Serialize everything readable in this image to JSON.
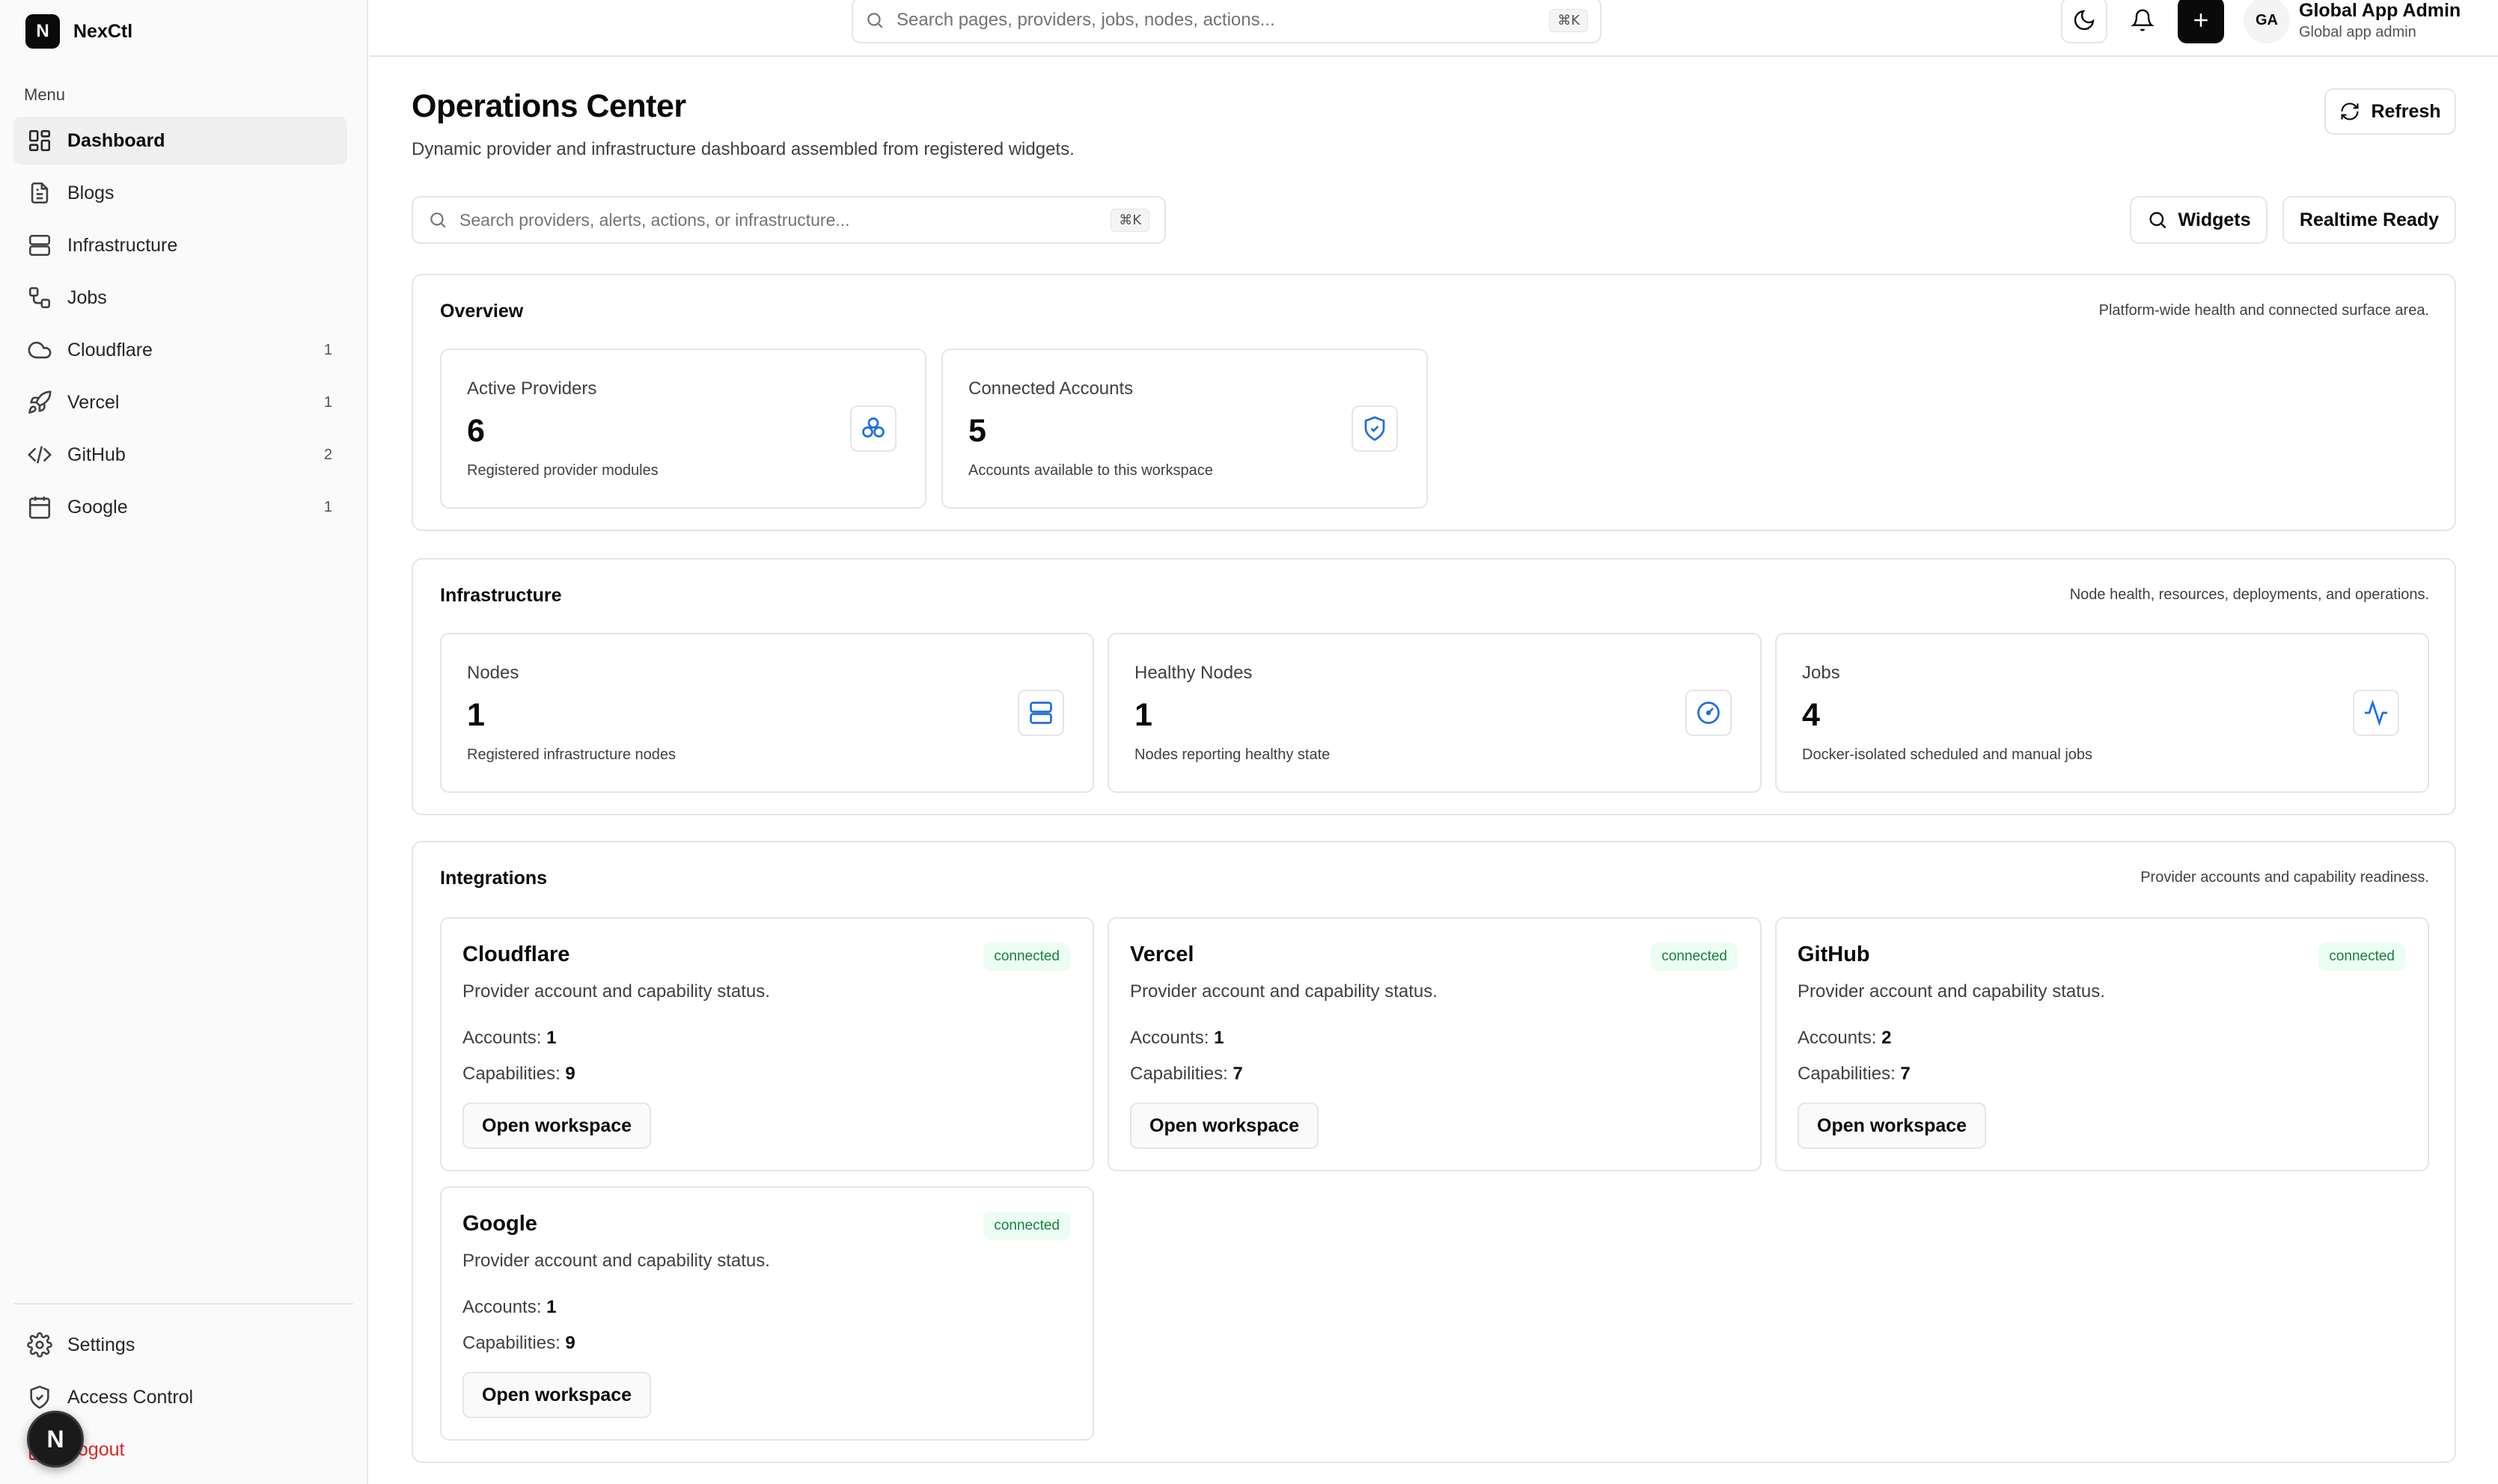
{
  "app": {
    "logo_letter": "N",
    "name": "NexCtl"
  },
  "sidebar": {
    "menu_label": "Menu",
    "items": [
      {
        "label": "Dashboard",
        "count": "",
        "icon": "dashboard-icon"
      },
      {
        "label": "Blogs",
        "count": "",
        "icon": "document-icon"
      },
      {
        "label": "Infrastructure",
        "count": "",
        "icon": "server-icon"
      },
      {
        "label": "Jobs",
        "count": "",
        "icon": "workflow-icon"
      },
      {
        "label": "Cloudflare",
        "count": "1",
        "icon": "cloud-icon"
      },
      {
        "label": "Vercel",
        "count": "1",
        "icon": "rocket-icon"
      },
      {
        "label": "GitHub",
        "count": "2",
        "icon": "code-icon"
      },
      {
        "label": "Google",
        "count": "1",
        "icon": "calendar-icon"
      }
    ],
    "bottom_items": [
      {
        "label": "Settings",
        "icon": "gear-icon"
      },
      {
        "label": "Access Control",
        "icon": "shield-icon"
      },
      {
        "label": "Logout",
        "icon": "logout-icon"
      }
    ],
    "floating_letter": "N"
  },
  "topbar": {
    "search_placeholder": "Search pages, providers, jobs, nodes, actions...",
    "search_shortcut": "⌘K",
    "user_initials": "GA",
    "user_name": "Global App Admin",
    "user_role": "Global app admin"
  },
  "header": {
    "title": "Operations Center",
    "subtitle": "Dynamic provider and infrastructure dashboard assembled from registered widgets.",
    "refresh_label": "Refresh"
  },
  "filters": {
    "search_placeholder": "Search providers, alerts, actions, or infrastructure...",
    "search_shortcut": "⌘K",
    "widgets_label": "Widgets",
    "realtime_label": "Realtime Ready"
  },
  "overview": {
    "title": "Overview",
    "description": "Platform-wide health and connected surface area.",
    "cards": [
      {
        "label": "Active Providers",
        "value": "6",
        "sub": "Registered provider modules",
        "icon": "providers-icon"
      },
      {
        "label": "Connected Accounts",
        "value": "5",
        "sub": "Accounts available to this workspace",
        "icon": "shield-check-icon"
      }
    ]
  },
  "infrastructure": {
    "title": "Infrastructure",
    "description": "Node health, resources, deployments, and operations.",
    "cards": [
      {
        "label": "Nodes",
        "value": "1",
        "sub": "Registered infrastructure nodes",
        "icon": "server-icon"
      },
      {
        "label": "Healthy Nodes",
        "value": "1",
        "sub": "Nodes reporting healthy state",
        "icon": "gauge-icon"
      },
      {
        "label": "Jobs",
        "value": "4",
        "sub": "Docker-isolated scheduled and manual jobs",
        "icon": "activity-icon"
      }
    ]
  },
  "integrations": {
    "title": "Integrations",
    "description": "Provider accounts and capability readiness.",
    "accounts_label": "Accounts:",
    "capabilities_label": "Capabilities:",
    "button_label": "Open workspace",
    "cards": [
      {
        "name": "Cloudflare",
        "status": "connected",
        "desc": "Provider account and capability status.",
        "accounts": "1",
        "capabilities": "9"
      },
      {
        "name": "Vercel",
        "status": "connected",
        "desc": "Provider account and capability status.",
        "accounts": "1",
        "capabilities": "7"
      },
      {
        "name": "GitHub",
        "status": "connected",
        "desc": "Provider account and capability status.",
        "accounts": "2",
        "capabilities": "7"
      },
      {
        "name": "Google",
        "status": "connected",
        "desc": "Provider account and capability status.",
        "accounts": "1",
        "capabilities": "9"
      }
    ]
  },
  "colors": {
    "accent_blue": "#1d6fe0",
    "success_text": "#15803d",
    "success_bg": "#ecfdf3",
    "logout_red": "#dc2626"
  }
}
